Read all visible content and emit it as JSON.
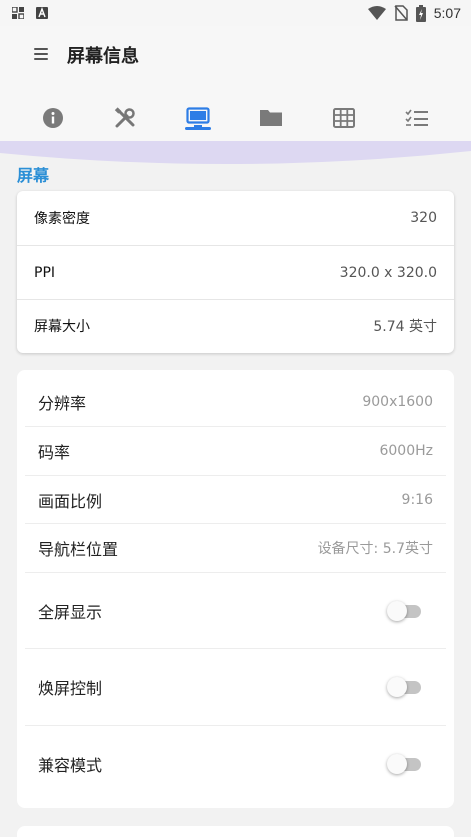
{
  "status_bar": {
    "time": "5:07",
    "left_icons": [
      "notification-grid-icon",
      "text-a-icon"
    ],
    "right_icons": [
      "wifi-icon",
      "no-sim-icon",
      "battery-charging-icon"
    ]
  },
  "app_bar": {
    "title": "屏幕信息",
    "menu_icon": "menu-icon"
  },
  "tabs": [
    {
      "icon": "info-icon",
      "active": false
    },
    {
      "icon": "tools-icon",
      "active": false
    },
    {
      "icon": "monitor-icon",
      "active": true
    },
    {
      "icon": "folder-icon",
      "active": false
    },
    {
      "icon": "grid-icon",
      "active": false
    },
    {
      "icon": "checklist-icon",
      "active": false
    }
  ],
  "colors": {
    "accent": "#2d7de6",
    "section_title": "#2b8fd6",
    "wave": "#ddd8f2",
    "toggle_off": "#c4c4c4"
  },
  "section": {
    "title": "屏幕"
  },
  "screen_card": {
    "rows": [
      {
        "label": "像素密度",
        "value": "320"
      },
      {
        "label": "PPI",
        "value": "320.0 x 320.0"
      },
      {
        "label": "屏幕大小",
        "value": "5.74 英寸"
      }
    ]
  },
  "settings_card": {
    "rows": [
      {
        "label": "分辨率",
        "value": "900x1600"
      },
      {
        "label": "码率",
        "value": "6000Hz"
      },
      {
        "label": "画面比例",
        "value": "9:16"
      },
      {
        "label": "导航栏位置",
        "value": "设备尺寸: 5.7英寸"
      }
    ],
    "toggles": [
      {
        "label": "全屏显示",
        "on": false
      },
      {
        "label": "焕屏控制",
        "on": false
      },
      {
        "label": "兼容模式",
        "on": false
      }
    ]
  }
}
